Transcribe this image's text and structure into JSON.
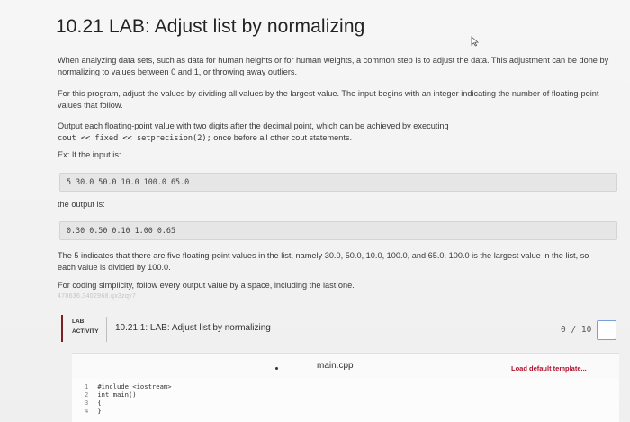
{
  "page": {
    "title": "10.21 LAB: Adjust list by normalizing",
    "para1": "When analyzing data sets, such as data for human heights or for human weights, a common step is to adjust the data. This adjustment can be done by normalizing to values between 0 and 1, or throwing away outliers.",
    "para2": "For this program, adjust the values by dividing all values by the largest value. The input begins with an integer indicating the number of floating-point values that follow.",
    "para3_pre": "Output each floating-point value with two digits after the decimal point, which can be achieved by executing",
    "para3_code": "cout << fixed << setprecision(2);",
    "para3_post": " once before all other cout statements.",
    "example_label": "Ex: If the input is:",
    "example_input": "5 30.0 50.0 10.0 100.0 65.0",
    "output_label": "the output is:",
    "example_output": "0.30 0.50 0.10 1.00 0.65",
    "para4": "The 5 indicates that there are five floating-point values in the list, namely 30.0, 50.0, 10.0, 100.0, and 65.0. 100.0 is the largest value in the list, so each value is divided by 100.0.",
    "para5": "For coding simplicity, follow every output value by a space, including the last one.",
    "faint_text": "478636.3402968.qx3zqy7"
  },
  "lab": {
    "badge_line1": "LAB",
    "badge_line2": "ACTIVITY",
    "title": "10.21.1: LAB: Adjust list by normalizing",
    "score": "0 / 10"
  },
  "editor": {
    "file_name": "main.cpp",
    "load_template": "Load default template...",
    "lines": [
      {
        "num": "1",
        "code": "#include <iostream>"
      },
      {
        "num": "2",
        "code": "int main()"
      },
      {
        "num": "3",
        "code": "{"
      },
      {
        "num": "4",
        "code": "}"
      }
    ]
  },
  "colors": {
    "accent_red": "#b0122e",
    "badge_border": "#7a2020",
    "score_box_border": "#7a9fd8"
  }
}
